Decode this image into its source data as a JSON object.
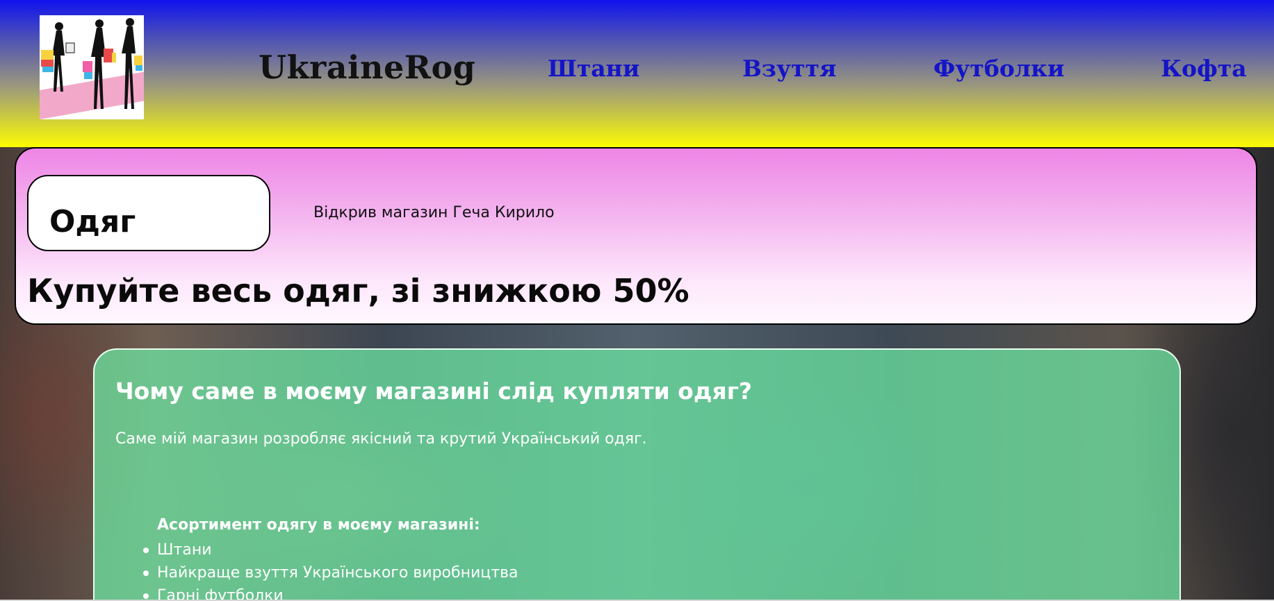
{
  "header": {
    "logo_alt": "shopping women logo",
    "brand": "UkraineRog",
    "nav": [
      {
        "label": "Штани"
      },
      {
        "label": "Взуття"
      },
      {
        "label": "Футболки"
      },
      {
        "label": "Кофта"
      }
    ],
    "colors": {
      "top": "#0f12ee",
      "bottom": "#fcfc03",
      "nav_link": "#1414c8"
    }
  },
  "hero": {
    "category": "Одяг",
    "opened_by": "Відкрив магазин Геча Кирило",
    "discount": "Купуйте весь одяг, зі знижкою 50%",
    "colors": {
      "top": "#ee85e6",
      "bottom": "#fff8ff"
    }
  },
  "info": {
    "title": "Чому саме в моєму магазині слід купляти одяг?",
    "text": "Саме мій магазин розробляє якісний та крутий Український одяг.",
    "assortment_title": "Асортимент одягу в моєму магазині:",
    "assortment": [
      "Штани",
      "Найкраще взуття Українського виробництва",
      "Гарні футболки"
    ],
    "colors": {
      "panel": "#6eeba5",
      "text": "#ffffff"
    }
  }
}
